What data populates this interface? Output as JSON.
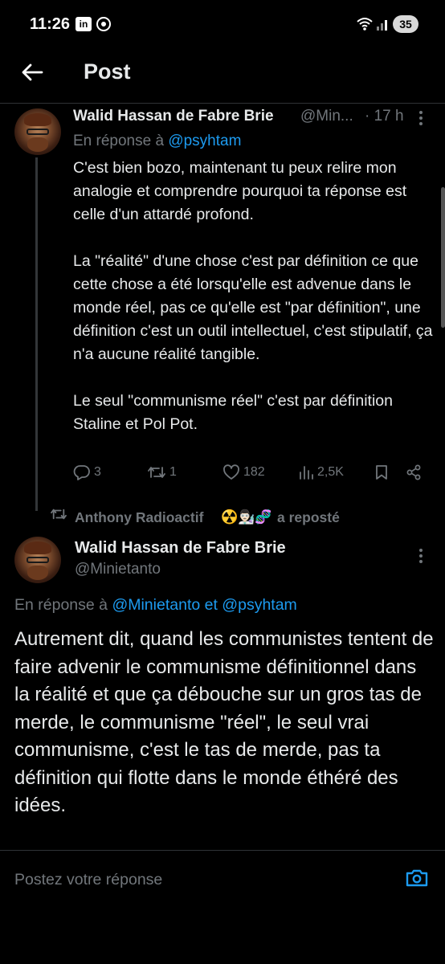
{
  "status_bar": {
    "time": "11:26",
    "linkedin_badge": "in",
    "battery": "35"
  },
  "header": {
    "title": "Post"
  },
  "parent_tweet": {
    "author_name": "Walid Hassan de Fabre Brie",
    "handle_truncated": "@Min...",
    "time": "· 17 h",
    "reply_prefix": "En réponse à",
    "reply_mention": "@psyhtam",
    "paragraphs": [
      "C'est bien bozo, maintenant tu peux relire mon analogie et comprendre pourquoi ta réponse est celle d'un attardé profond.",
      "La \"réalité\" d'une chose c'est par définition ce que cette chose a été lorsqu'elle est advenue dans le monde réel, pas ce qu'elle est \"par définition\", une définition c'est un outil intellectuel, c'est stipulatif, ça n'a aucune réalité tangible.",
      "Le seul \"communisme réel\" c'est par définition Staline et Pol Pot."
    ],
    "actions": {
      "replies": "3",
      "reposts": "1",
      "likes": "182",
      "views": "2,5K"
    }
  },
  "repost_line": {
    "name": "Anthony Radioactif",
    "emojis": "☢️👨🏻‍🔬🧬",
    "suffix": "a reposté"
  },
  "main_tweet": {
    "author_name": "Walid Hassan de Fabre Brie",
    "handle": "@Minietanto",
    "reply_prefix": "En réponse à",
    "reply_mentions": "@Minietanto et @psyhtam",
    "text": "Autrement dit, quand les communistes tentent de faire advenir le communisme définitionnel dans la réalité et que ça débouche sur un gros tas de merde, le communisme \"réel\", le seul vrai communisme, c'est le tas de merde, pas ta définition qui flotte dans le monde éthéré des idées."
  },
  "reply_box": {
    "placeholder": "Postez votre réponse"
  },
  "colors": {
    "background": "#000000",
    "text": "#e7e9ea",
    "muted": "#71767b",
    "accent": "#1d9bf0"
  }
}
